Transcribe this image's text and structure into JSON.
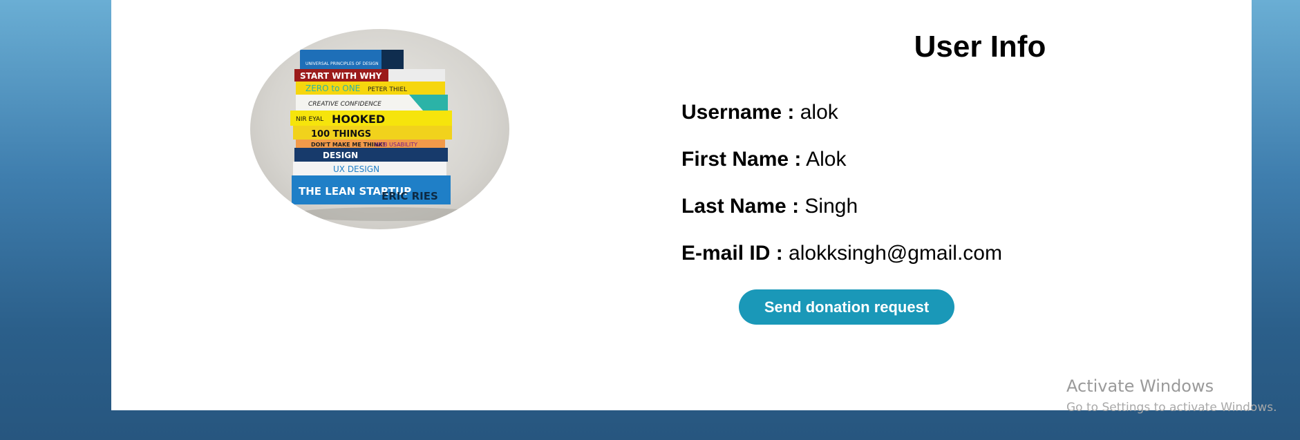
{
  "profile": {
    "title": "User Info",
    "fields": [
      {
        "label": "Username :",
        "value": "alok"
      },
      {
        "label": "First Name :",
        "value": "Alok"
      },
      {
        "label": "Last Name :",
        "value": "Singh"
      },
      {
        "label": "E-mail ID :",
        "value": "alokksingh@gmail.com"
      }
    ],
    "button_label": "Send donation request"
  },
  "books": [
    "UNIVERSAL PRINCIPLES OF DESIGN",
    "START WITH WHY",
    "ZERO to ONE",
    "PETER THIEL",
    "CREATIVE CONFIDENCE",
    "NIR EYAL",
    "HOOKED",
    "100 THINGS",
    "DON'T MAKE ME THINK!",
    "WEB USABILITY",
    "DESIGN",
    "UX DESIGN",
    "THE LEAN STARTUP",
    "ERIC RIES"
  ],
  "watermark": {
    "title": "Activate Windows",
    "subtitle": "Go to Settings to activate Windows."
  },
  "colors": {
    "button": "#1a98b8",
    "background_top": "#6aaed4",
    "background_bottom": "#27567f"
  }
}
